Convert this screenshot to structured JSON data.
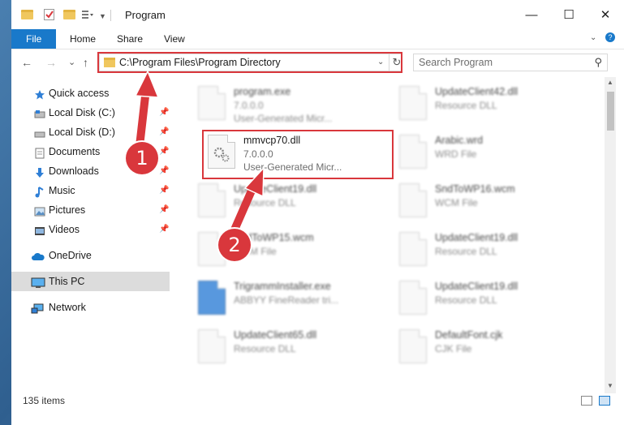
{
  "window": {
    "title": "Program",
    "controls": {
      "minimize": "—",
      "maximize": "☐",
      "close": "✕"
    }
  },
  "ribbon": {
    "tabs": [
      {
        "label": "File",
        "active": true
      },
      {
        "label": "Home"
      },
      {
        "label": "Share"
      },
      {
        "label": "View"
      }
    ],
    "expand_icon": "chevron-down",
    "help_icon": "?"
  },
  "address": {
    "path": "C:\\Program Files\\Program Directory",
    "dropdown_glyph": "⌄",
    "refresh_glyph": "↻"
  },
  "search": {
    "placeholder": "Search Program",
    "icon_glyph": "⚲"
  },
  "nav": {
    "back": "←",
    "forward": "→",
    "recent": "⌄",
    "up": "↑"
  },
  "sidebar": {
    "items": [
      {
        "label": "Quick access",
        "icon": "star-icon",
        "pinned": false
      },
      {
        "label": "Local Disk (C:)",
        "icon": "drive-icon",
        "pinned": true
      },
      {
        "label": "Local Disk (D:)",
        "icon": "drive-icon",
        "pinned": true
      },
      {
        "label": "Documents",
        "icon": "documents-icon",
        "pinned": true
      },
      {
        "label": "Downloads",
        "icon": "download-icon",
        "pinned": true
      },
      {
        "label": "Music",
        "icon": "music-icon",
        "pinned": true
      },
      {
        "label": "Pictures",
        "icon": "pictures-icon",
        "pinned": true
      },
      {
        "label": "Videos",
        "icon": "videos-icon",
        "pinned": true
      },
      {
        "label": "OneDrive",
        "icon": "cloud-icon",
        "pinned": false
      },
      {
        "label": "This PC",
        "icon": "computer-icon",
        "pinned": false,
        "selected": true
      },
      {
        "label": "Network",
        "icon": "network-icon",
        "pinned": false
      }
    ],
    "pin_glyph": "📌"
  },
  "files": [
    {
      "name": "program.exe",
      "line2": "7.0.0.0",
      "line3": "User-Generated Micr..."
    },
    {
      "name": "UpdateClient42.dll",
      "line2": "Resource DLL",
      "line3": ""
    },
    {
      "name": "mmvcp70.dll",
      "line2": "7.0.0.0",
      "line3": "User-Generated Micr...",
      "highlighted": true
    },
    {
      "name": "Arabic.wrd",
      "line2": "WRD File",
      "line3": ""
    },
    {
      "name": "UpdateClient19.dll",
      "line2": "Resource DLL",
      "line3": ""
    },
    {
      "name": "SndToWP16.wcm",
      "line2": "WCM File",
      "line3": ""
    },
    {
      "name": "SndToWP15.wcm",
      "line2": "WCM File",
      "line3": ""
    },
    {
      "name": "UpdateClient19.dll",
      "line2": "Resource DLL",
      "line3": ""
    },
    {
      "name": "TrigrammInstaller.exe",
      "line2": "ABBYY FineReader tri...",
      "line3": ""
    },
    {
      "name": "UpdateClient19.dll",
      "line2": "Resource DLL",
      "line3": ""
    },
    {
      "name": "UpdateClient65.dll",
      "line2": "Resource DLL",
      "line3": ""
    },
    {
      "name": "DefaultFont.cjk",
      "line2": "CJK File",
      "line3": ""
    }
  ],
  "status": {
    "item_count": "135 items"
  },
  "annotations": {
    "marker1": "1",
    "marker2": "2"
  },
  "colors": {
    "accent": "#1979ca",
    "highlight": "#d9373c"
  }
}
